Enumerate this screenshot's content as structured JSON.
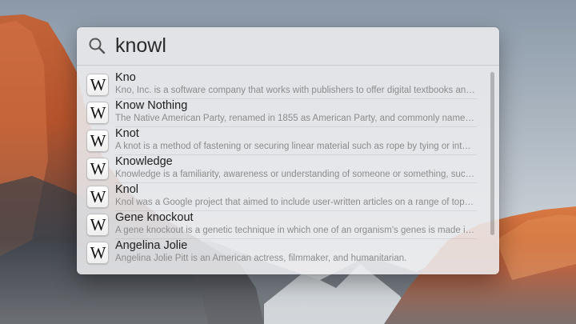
{
  "search": {
    "query": "knowl"
  },
  "results": [
    {
      "icon": "wikipedia-icon",
      "icon_glyph": "W",
      "title": "Kno",
      "description": "Kno, Inc. is a software company that works with publishers to offer digital textbooks and o..."
    },
    {
      "icon": "wikipedia-icon",
      "icon_glyph": "W",
      "title": "Know Nothing",
      "description": "The Native American Party, renamed in 1855 as American Party, and commonly named Kn..."
    },
    {
      "icon": "wikipedia-icon",
      "icon_glyph": "W",
      "title": "Knot",
      "description": "A knot is a method of fastening or securing linear material such as rope by tying or interw..."
    },
    {
      "icon": "wikipedia-icon",
      "icon_glyph": "W",
      "title": "Knowledge",
      "description": "Knowledge is a familiarity, awareness or understanding of someone or something, such as..."
    },
    {
      "icon": "wikipedia-icon",
      "icon_glyph": "W",
      "title": "Knol",
      "description": "Knol was a Google project that aimed to include user-written articles on a range of topics...."
    },
    {
      "icon": "wikipedia-icon",
      "icon_glyph": "W",
      "title": "Gene knockout",
      "description": "A gene knockout is a genetic technique in which one of an organism's genes is made inop..."
    },
    {
      "icon": "wikipedia-icon",
      "icon_glyph": "W",
      "title": "Angelina Jolie",
      "description": "Angelina Jolie Pitt is an American actress, filmmaker, and humanitarian."
    }
  ]
}
